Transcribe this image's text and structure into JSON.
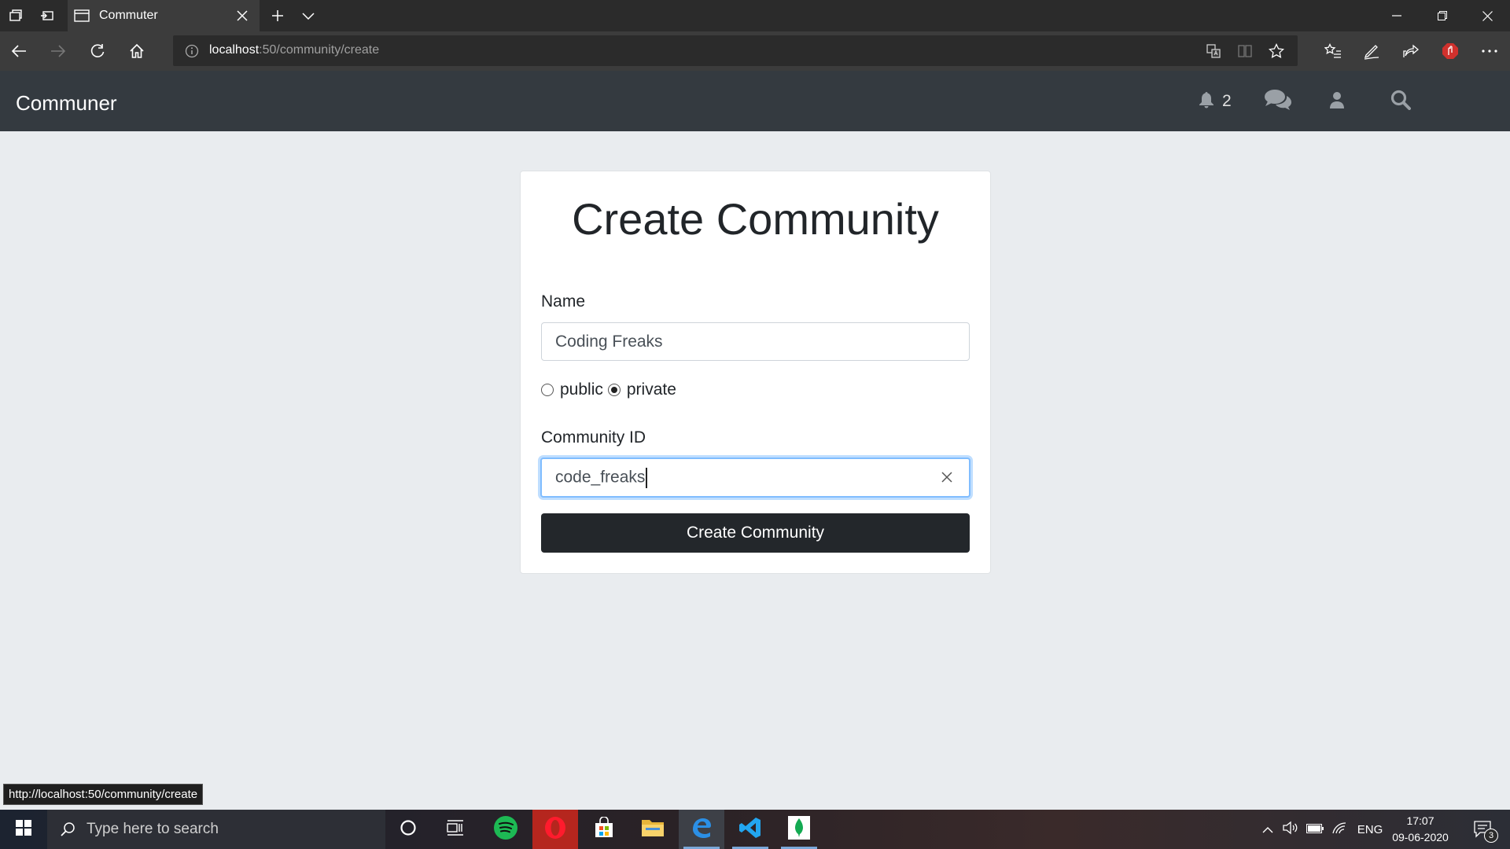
{
  "browser": {
    "tab_title": "Commuter",
    "url_host": "localhost",
    "url_rest": ":50/community/create"
  },
  "app": {
    "brand": "Communer",
    "notification_count": "2"
  },
  "form": {
    "title": "Create Community",
    "name_label": "Name",
    "name_value": "Coding Freaks",
    "visibility_options": [
      "public",
      "private"
    ],
    "visibility_selected": "private",
    "id_label": "Community ID",
    "id_value": "code_freaks",
    "submit_label": "Create Community"
  },
  "status_bar": {
    "link_preview": "http://localhost:50/community/create"
  },
  "taskbar": {
    "search_placeholder": "Type here to search",
    "language": "ENG",
    "time": "17:07",
    "date": "09-06-2020",
    "notification_count": "3"
  },
  "colors": {
    "navbar": "#343a40",
    "page_bg": "#e9ecef",
    "button": "#23272b",
    "focus_border": "#80bdff"
  }
}
